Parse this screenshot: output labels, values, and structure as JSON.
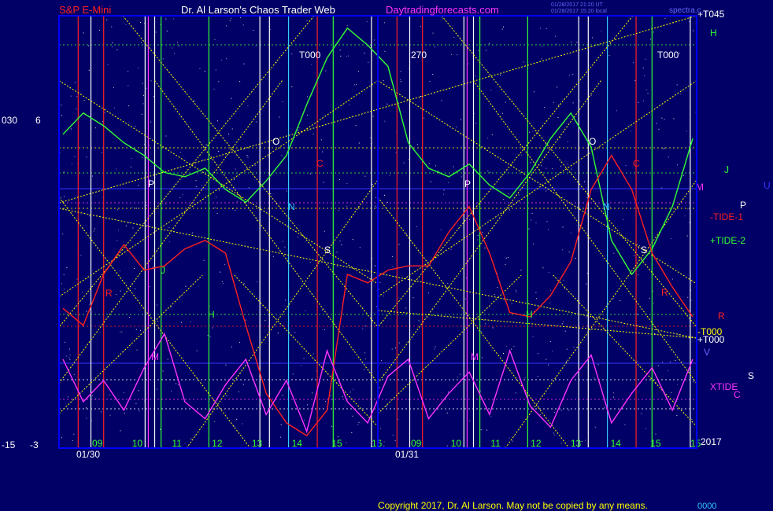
{
  "header": {
    "symbol": "S&P E-Mini",
    "site": "Dr. Al Larson's Chaos Trader Web",
    "domain": "Daytradingforecasts.com",
    "stamp1": "01/28/2017 21:20 UT",
    "stamp2": "01/28/2017 15:20 local",
    "stamp3": "spectra.c..."
  },
  "footer": {
    "copyright": "Copyright 2017, Dr. Al Larson. May not be copied by any means.",
    "tag": "0000"
  },
  "left_axis": [
    "030",
    "6",
    "-15",
    "-3"
  ],
  "colors": {
    "bg": "#000066",
    "frame": "#0000ff",
    "red": "#ff2020",
    "green": "#33ff33",
    "magenta": "#ff33ff",
    "yellow": "#ffff00",
    "white": "#ffffff",
    "cyan": "#33ccff"
  },
  "chart_data": {
    "type": "line",
    "title": "S&P E-Mini",
    "days": [
      "01/30",
      "01/31"
    ],
    "hour_ticks": [
      [
        "09",
        "10",
        "11",
        "12",
        "13",
        "14",
        "15",
        "16"
      ],
      [
        "09",
        "10",
        "11",
        "12",
        "13",
        "14",
        "15",
        "15"
      ]
    ],
    "right_labels": [
      "+T045",
      "H",
      "J",
      "M",
      "U",
      "P",
      "-TIDE-1",
      "+TIDE-2",
      "R",
      "-T000",
      "+T000",
      "V",
      "XTIDE",
      "C",
      "S",
      "2017"
    ],
    "markers": [
      "T000",
      "270",
      "T000",
      "O",
      "P",
      "N",
      "S",
      "R",
      "J",
      "H",
      "M",
      "C",
      "O",
      "P",
      "N",
      "S",
      "R",
      "H",
      "M",
      "C"
    ],
    "series": [
      {
        "name": "+TIDE-2",
        "color": "#33ff33",
        "values": [
          0.73,
          0.78,
          0.75,
          0.71,
          0.68,
          0.64,
          0.63,
          0.65,
          0.6,
          0.57,
          0.62,
          0.68,
          0.8,
          0.91,
          0.98,
          0.94,
          0.89,
          0.71,
          0.65,
          0.63,
          0.66,
          0.61,
          0.58,
          0.64,
          0.72,
          0.78,
          0.7,
          0.48,
          0.4,
          0.46,
          0.56,
          0.72
        ]
      },
      {
        "name": "-TIDE-1",
        "color": "#ff2020",
        "values": [
          0.32,
          0.28,
          0.4,
          0.47,
          0.41,
          0.42,
          0.46,
          0.48,
          0.45,
          0.28,
          0.12,
          0.05,
          0.02,
          0.08,
          0.4,
          0.38,
          0.41,
          0.42,
          0.42,
          0.5,
          0.56,
          0.45,
          0.31,
          0.3,
          0.35,
          0.43,
          0.6,
          0.68,
          0.6,
          0.45,
          0.37,
          0.3
        ]
      },
      {
        "name": "XTIDE",
        "color": "#ff33ff",
        "values": [
          0.2,
          0.1,
          0.15,
          0.08,
          0.18,
          0.26,
          0.1,
          0.06,
          0.14,
          0.2,
          0.07,
          0.15,
          0.03,
          0.22,
          0.1,
          0.05,
          0.16,
          0.2,
          0.06,
          0.12,
          0.17,
          0.07,
          0.22,
          0.09,
          0.04,
          0.15,
          0.21,
          0.05,
          0.12,
          0.18,
          0.08,
          0.2
        ]
      }
    ]
  }
}
